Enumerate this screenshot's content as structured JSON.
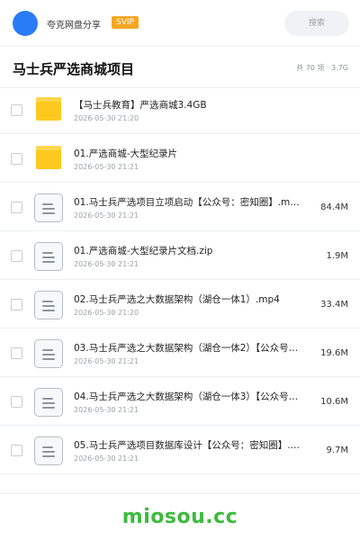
{
  "header": {
    "app_name": "夸克网盘分享",
    "badge": "SVIP",
    "search_placeholder": "搜索"
  },
  "folder": {
    "title": "马士兵严选商城项目",
    "count": "共 70 项",
    "separator": "·",
    "total_size": "3.7G"
  },
  "files": [
    {
      "type": "folder",
      "name": "【马士兵教育】严选商城3.4GB",
      "date": "2026-05-30 21:20",
      "size": ""
    },
    {
      "type": "folder",
      "name": "01.严选商城-大型纪录片",
      "date": "2026-05-30 21:21",
      "size": ""
    },
    {
      "type": "file",
      "name": "01.马士兵严选项目立项启动【公众号：密知圈】.m…",
      "date": "2026-05-30 21:21",
      "size": "84.4M"
    },
    {
      "type": "file",
      "name": "01.严选商城-大型纪录片文档.zip",
      "date": "2026-05-30 21:21",
      "size": "1.9M"
    },
    {
      "type": "file",
      "name": "02.马士兵严选之大数据架构（湖仓一体1）.mp4",
      "date": "2026-05-30 21:20",
      "size": "33.4M"
    },
    {
      "type": "file",
      "name": "03.马士兵严选之大数据架构（湖仓一体2）【公众号…",
      "date": "2026-05-30 21:21",
      "size": "19.6M"
    },
    {
      "type": "file",
      "name": "04.马士兵严选之大数据架构（湖仓一体3）【公众号…",
      "date": "2026-05-30 21:21",
      "size": "10.6M"
    },
    {
      "type": "file",
      "name": "05.马士兵严选项目数据库设计【公众号：密知圈】.…",
      "date": "2026-05-30 21:21",
      "size": "9.7M"
    }
  ],
  "watermark": "miosou.cc",
  "colors": {
    "avatar": "#2a7bf6",
    "badge": "#f5a623",
    "folder_icon": "#ffc81f",
    "watermark": "#3dbb3d"
  }
}
